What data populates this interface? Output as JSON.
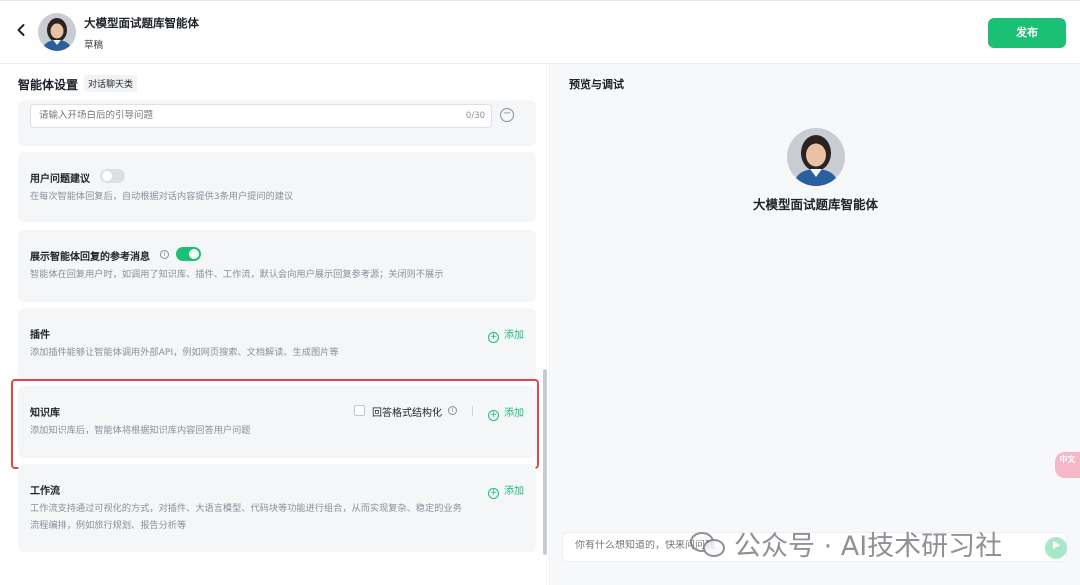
{
  "header": {
    "back_icon": "chevron-left-icon",
    "title": "大模型面试题库智能体",
    "status": "草稿",
    "publish_label": "发布"
  },
  "left": {
    "section_title": "智能体设置",
    "section_tag": "对话聊天类",
    "opening_question": {
      "placeholder": "请输入开场白后的引导问题",
      "counter": "0/30"
    },
    "suggestions": {
      "title": "用户问题建议",
      "enabled": false,
      "desc": "在每次智能体回复后，自动根据对话内容提供3条用户提问的建议"
    },
    "references": {
      "title": "展示智能体回复的参考消息",
      "enabled": true,
      "desc": "智能体在回复用户时，如调用了知识库、插件、工作流，默认会向用户展示回复参考源；关闭则不展示"
    },
    "plugins": {
      "title": "插件",
      "add_label": "添加",
      "desc": "添加插件能够让智能体调用外部API，例如网页搜索、文档解读、生成图片等"
    },
    "knowledge": {
      "title": "知识库",
      "structured_label": "回答格式结构化",
      "add_label": "添加",
      "desc": "添加知识库后，智能体将根据知识库内容回答用户问题"
    },
    "workflow": {
      "title": "工作流",
      "add_label": "添加",
      "desc_line1": "工作流支持通过可视化的方式，对插件、大语言模型、代码块等功能进行组合，从而实现复杂、稳定的业务",
      "desc_line2": "流程编排，例如旅行规划、报告分析等"
    }
  },
  "right": {
    "title": "预览与调试",
    "agent_name": "大模型面试题库智能体",
    "chat_placeholder": "你有什么想知道的，快来问问我",
    "send_icon": "send-icon",
    "translate_label": "中文"
  },
  "watermark": {
    "text": "公众号 · AI技术研习社"
  },
  "colors": {
    "accent": "#1cc074",
    "highlight": "#e0464b"
  }
}
